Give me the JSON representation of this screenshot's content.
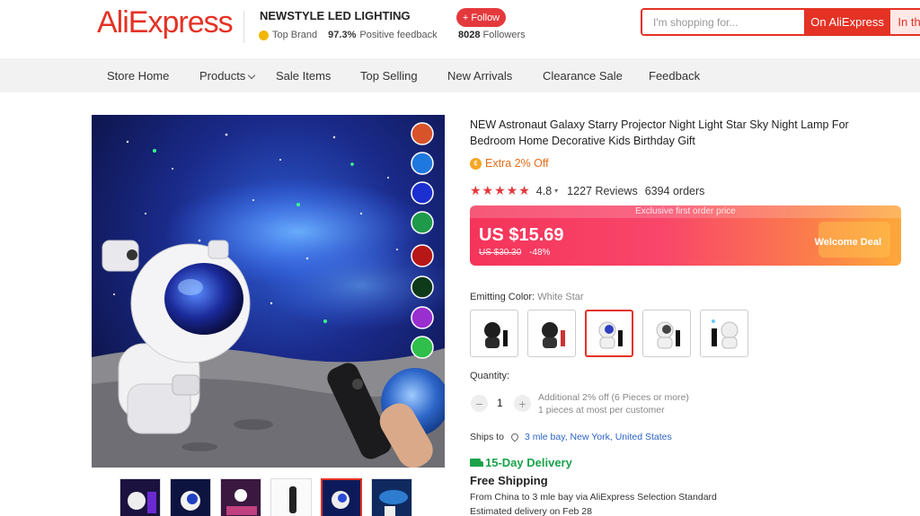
{
  "header": {
    "logo": "AliExpress",
    "store_name": "NEWSTYLE LED LIGHTING",
    "top_brand": "Top Brand",
    "positive_pct": "97.3%",
    "positive_label": "Positive feedback",
    "follow_label": "+ Follow",
    "followers_count": "8028",
    "followers_label": "Followers",
    "search_placeholder": "I'm shopping for...",
    "search_button": "On AliExpress",
    "search_button2": "In th"
  },
  "nav": {
    "items": [
      "Store Home",
      "Products",
      "Sale Items",
      "Top Selling",
      "New Arrivals",
      "Clearance Sale",
      "Feedback"
    ]
  },
  "product": {
    "title": "NEW Astronaut Galaxy Starry Projector Night Light Star Sky Night Lamp For Bedroom Home Decorative Kids Birthday Gift",
    "extra_off": "Extra 2% Off",
    "stars": "★★★★★",
    "rating": "4.8",
    "reviews": "1227 Reviews",
    "orders": "6394 orders",
    "price_banner": "Exclusive first order price",
    "price": "US $15.69",
    "old_price": "US $30.30",
    "discount": "-48%",
    "welcome_deal": "Welcome Deal",
    "color_label": "Emitting Color:",
    "color_value": "White Star",
    "quantity_label": "Quantity:",
    "quantity_value": "1",
    "qty_minus": "−",
    "qty_plus": "+",
    "qty_note_1": "Additional 2% off (6 Pieces or more)",
    "qty_note_2": "1 pieces at most per customer",
    "ships_to_label": "Ships to",
    "ships_to_location": "3 mle bay, New York, United States",
    "delivery": "15-Day Delivery",
    "free_shipping": "Free Shipping",
    "from_line": "From China to 3 mle bay via AliExpress Selection Standard",
    "est_line": "Estimated delivery on Feb 28"
  },
  "colors": {
    "brand_red": "#e43225",
    "delivery_green": "#1aa34a",
    "link_blue": "#2c63c4"
  }
}
